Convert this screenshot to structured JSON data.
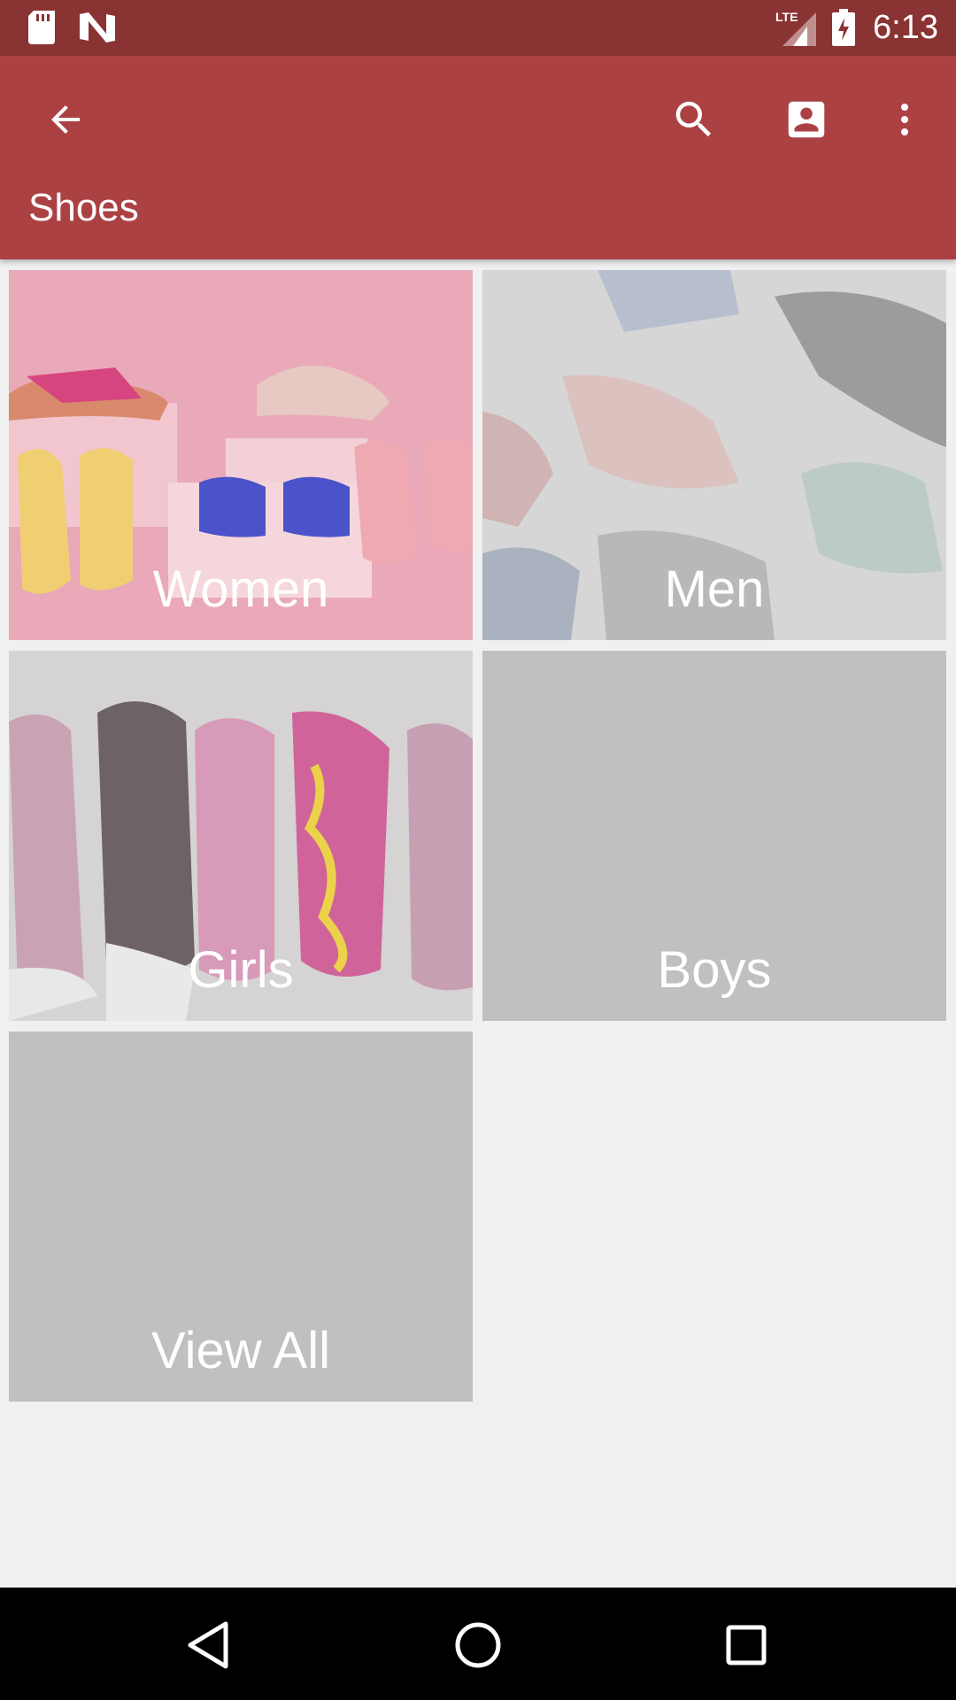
{
  "status_bar": {
    "time": "6:13",
    "network": "LTE",
    "icons": [
      "sd-card-icon",
      "n-notification-icon",
      "lte-signal-icon",
      "battery-charging-icon"
    ]
  },
  "app_bar": {
    "title": "Shoes",
    "actions": [
      "back-arrow-icon",
      "search-icon",
      "account-box-icon",
      "more-vert-icon"
    ],
    "color": "#ab4143"
  },
  "categories": [
    {
      "label": "Women",
      "tint": "#e8a6b5"
    },
    {
      "label": "Men",
      "tint": "#d4d4d4"
    },
    {
      "label": "Girls",
      "tint": "#cfcfcf"
    },
    {
      "label": "Boys",
      "tint": "#c0c0c0"
    },
    {
      "label": "View All",
      "tint": "#c0c0c0"
    }
  ],
  "nav_bar": {
    "buttons": [
      "back-triangle-icon",
      "home-circle-icon",
      "recents-square-icon"
    ]
  }
}
